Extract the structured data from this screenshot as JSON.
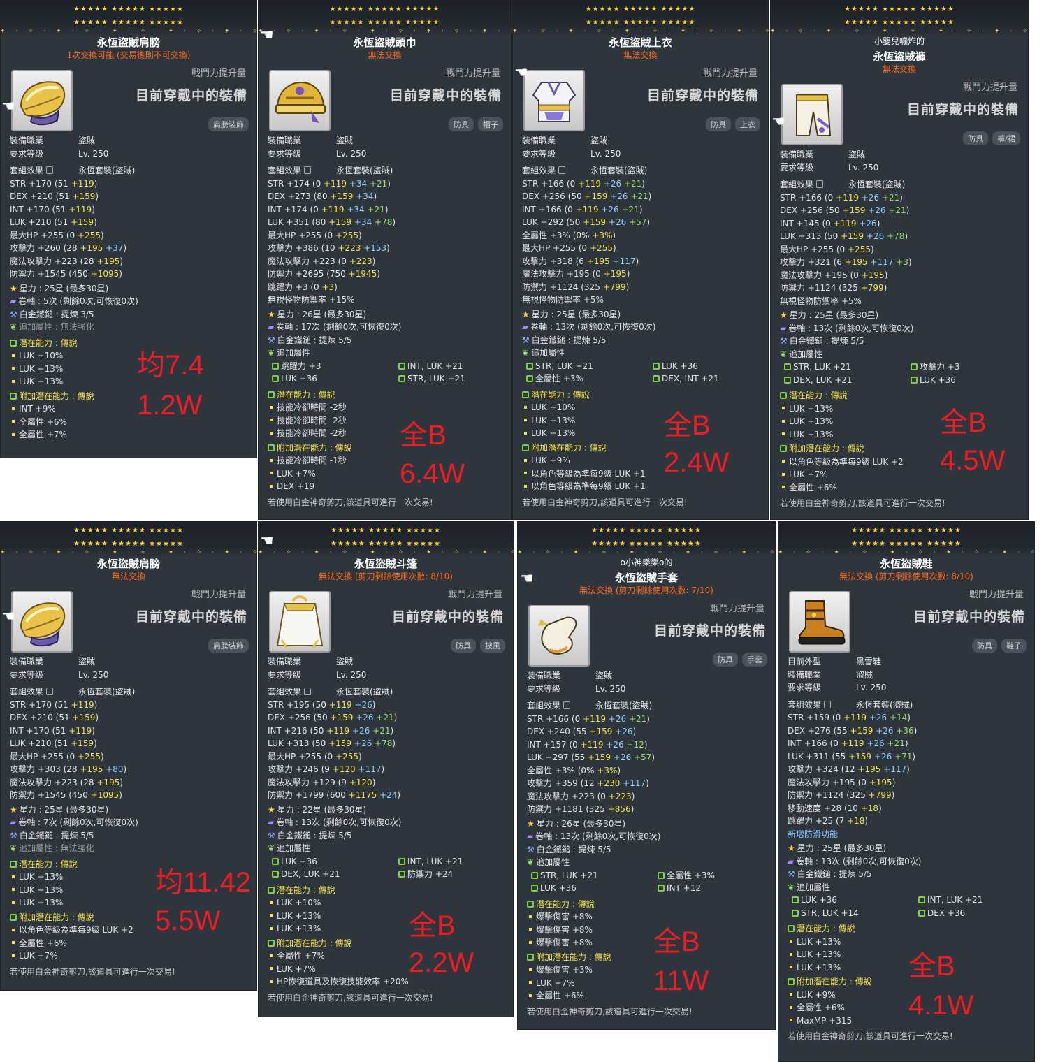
{
  "common": {
    "power_label": "戰鬥力提升量",
    "equipped": "目前穿戴中的裝備",
    "job_label": "裝備職業",
    "job": "盜賊",
    "level_label": "要求等級",
    "level": "Lv. 250",
    "set_label": "套組效果",
    "set_name": "永恆套裝(盜賊)",
    "footer": "若使用白金神奇剪刀,該道具可進行一次交易!"
  },
  "cards": [
    {
      "title": "永恆盜賊肩膀",
      "trade": "1次交換可能 (交易後則不可交換)",
      "tags": [
        "肩膀裝飾"
      ],
      "icon": "shoulder-icon",
      "stats": [
        "STR +170 (51 +119)",
        "DEX +210 (51 +159)",
        "INT +170 (51 +119)",
        "LUK +210 (51 +159)",
        "最大HP +255 (0 +255)",
        "攻擊力 +260 (28 +195 +37)",
        "魔法攻擊力 +223 (28 +195)",
        "防禦力 +1545 (450 +1095)"
      ],
      "star": "星力 : 25星 (最多30星)",
      "scroll": "卷軸 : 5次 (剩餘0次,可恢復0次)",
      "hammer": "白金鐵鎚 : 提煉 3/5",
      "add_label": "追加屬性 : 無法強化",
      "add": [],
      "pot_label": "潛在能力 : 傳說",
      "pot": [
        "LUK +10%",
        "LUK +13%",
        "LUK +13%"
      ],
      "bpot_label": "附加潛在能力 : 傳說",
      "bpot": [
        "INT +9%",
        "全屬性 +6%",
        "全屬性 +7%"
      ],
      "footer": "",
      "ann": [
        "均7.4",
        "1.2W"
      ]
    },
    {
      "title": "永恆盜賊頭巾",
      "trade": "無法交換",
      "tags": [
        "防具",
        "帽子"
      ],
      "icon": "helmet-icon",
      "stats": [
        "STR +174 (0 +119 +34 +21)",
        "DEX +273 (80 +159 +34)",
        "INT +174 (0 +119 +34 +21)",
        "LUK +351 (80 +159 +34 +78)",
        "最大HP +255 (0 +255)",
        "攻擊力 +386 (10 +223 +153)",
        "魔法攻擊力 +223 (0 +223)",
        "防禦力 +2695 (750 +1945)",
        "跳躍力 +3 (0 +3)",
        "無視怪物防禦率 +15%"
      ],
      "star": "星力 : 26星 (最多30星)",
      "scroll": "卷軸 : 17次 (剩餘0次,可恢復0次)",
      "hammer": "白金鐵鎚 : 提煉 5/5",
      "add_label": "追加屬性",
      "add": [
        "跳躍力 +3",
        "INT, LUK +21",
        "LUK +36",
        "STR, LUK +21"
      ],
      "pot_label": "潛在能力 : 傳說",
      "pot": [
        "技能冷卻時間 -2秒",
        "技能冷卻時間 -2秒",
        "技能冷卻時間 -2秒"
      ],
      "bpot_label": "附加潛在能力 : 傳說",
      "bpot": [
        "技能冷卻時間 -1秒",
        "LUK +7%",
        "DEX +19"
      ],
      "footer": "若使用白金神奇剪刀,該道具可進行一次交易!",
      "ann": [
        "全B",
        "6.4W"
      ]
    },
    {
      "title": "永恆盜賊上衣",
      "trade": "無法交換",
      "tags": [
        "防具",
        "上衣"
      ],
      "icon": "top-icon",
      "stats": [
        "STR +166 (0 +119 +26 +21)",
        "DEX +256 (50 +159 +26 +21)",
        "INT +166 (0 +119 +26 +21)",
        "LUK +292 (50 +159 +26 +57)",
        "全屬性 +3% (0% +3%)",
        "最大HP +255 (0 +255)",
        "攻擊力 +318 (6 +195 +117)",
        "魔法攻擊力 +195 (0 +195)",
        "防禦力 +1124 (325 +799)",
        "無視怪物防禦率 +5%"
      ],
      "star": "星力 : 25星 (最多30星)",
      "scroll": "卷軸 : 13次 (剩餘0次,可恢復0次)",
      "hammer": "白金鐵鎚 : 提煉 5/5",
      "add_label": "追加屬性",
      "add": [
        "STR, LUK +21",
        "LUK +36",
        "全屬性 +3%",
        "DEX, INT +21"
      ],
      "pot_label": "潛在能力 : 傳說",
      "pot": [
        "LUK +10%",
        "LUK +13%",
        "LUK +13%"
      ],
      "bpot_label": "附加潛在能力 : 傳說",
      "bpot": [
        "LUK +9%",
        "以角色等級為準每9級 LUK +1",
        "以角色等級為準每9級 LUK +1"
      ],
      "footer": "若使用白金神奇剪刀,該道具可進行一次交易!",
      "ann": [
        "全B",
        "2.4W"
      ]
    },
    {
      "owner": "小嬰兒嘣炸的",
      "title": "永恆盜賊褲",
      "trade": "無法交換",
      "tags": [
        "防具",
        "褲/裙"
      ],
      "icon": "pants-icon",
      "stats": [
        "STR +166 (0 +119 +26 +21)",
        "DEX +256 (50 +159 +26 +21)",
        "INT +145 (0 +119 +26)",
        "LUK +313 (50 +159 +26 +78)",
        "最大HP +255 (0 +255)",
        "攻擊力 +321 (6 +195 +117 +3)",
        "魔法攻擊力 +195 (0 +195)",
        "防禦力 +1124 (325 +799)",
        "無視怪物防禦率 +5%"
      ],
      "star": "星力 : 25星 (最多30星)",
      "scroll": "卷軸 : 13次 (剩餘0次,可恢復0次)",
      "hammer": "白金鐵鎚 : 提煉 5/5",
      "add_label": "追加屬性",
      "add": [
        "STR, LUK +21",
        "攻擊力 +3",
        "DEX, LUK +21",
        "LUK +36"
      ],
      "pot_label": "潛在能力 : 傳說",
      "pot": [
        "LUK +13%",
        "LUK +13%",
        "LUK +13%"
      ],
      "bpot_label": "附加潛在能力 : 傳說",
      "bpot": [
        "以角色等級為準每9級 LUK +2",
        "LUK +7%",
        "全屬性 +6%"
      ],
      "footer": "若使用白金神奇剪刀,該道具可進行一次交易!",
      "ann": [
        "全B",
        "4.5W"
      ]
    },
    {
      "title": "永恆盜賊肩膀",
      "trade": "無法交換",
      "tags": [
        "肩膀裝飾"
      ],
      "icon": "shoulder-icon",
      "stats": [
        "STR +170 (51 +119)",
        "DEX +210 (51 +159)",
        "INT +170 (51 +119)",
        "LUK +210 (51 +159)",
        "最大HP +255 (0 +255)",
        "攻擊力 +303 (28 +195 +80)",
        "魔法攻擊力 +223 (28 +195)",
        "防禦力 +1545 (450 +1095)"
      ],
      "star": "星力 : 25星 (最多30星)",
      "scroll": "卷軸 : 7次 (剩餘0次,可恢復0次)",
      "hammer": "白金鐵鎚 : 提煉 5/5",
      "add_label": "追加屬性 : 無法強化",
      "add": [],
      "pot_label": "潛在能力 : 傳說",
      "pot": [
        "LUK +13%",
        "LUK +13%",
        "LUK +13%"
      ],
      "bpot_label": "附加潛在能力 : 傳說",
      "bpot": [
        "以角色等級為準每9級 LUK +2",
        "全屬性 +6%",
        "LUK +7%"
      ],
      "footer": "若使用白金神奇剪刀,該道具可進行一次交易!",
      "ann": [
        "均11.42",
        "5.5W"
      ]
    },
    {
      "title": "永恆盜賊斗篷",
      "trade": "無法交換 (剪刀剩餘使用次數: 8/10)",
      "tags": [
        "防具",
        "披風"
      ],
      "icon": "cape-icon",
      "stats": [
        "STR +195 (50 +119 +26)",
        "DEX +256 (50 +159 +26 +21)",
        "INT +216 (50 +119 +26 +21)",
        "LUK +313 (50 +159 +26 +78)",
        "最大HP +255 (0 +255)",
        "攻擊力 +246 (9 +120 +117)",
        "魔法攻擊力 +129 (9 +120)",
        "防禦力 +1799 (600 +1175 +24)"
      ],
      "star": "星力 : 22星 (最多30星)",
      "scroll": "卷軸 : 13次 (剩餘0次,可恢復0次)",
      "hammer": "白金鐵鎚 : 提煉 5/5",
      "add_label": "追加屬性",
      "add": [
        "LUK +36",
        "INT, LUK +21",
        "DEX, LUK +21",
        "防禦力 +24"
      ],
      "pot_label": "潛在能力 : 傳說",
      "pot": [
        "LUK +10%",
        "LUK +13%",
        "LUK +13%"
      ],
      "bpot_label": "附加潛在能力 : 傳說",
      "bpot": [
        "全屬性 +7%",
        "LUK +7%",
        "HP恢復道具及恢復技能效率 +20%"
      ],
      "footer": "若使用白金神奇剪刀,該道具可進行一次交易!",
      "ann": [
        "全B",
        "2.2W"
      ]
    },
    {
      "owner": "o小神樂樂o的",
      "title": "永恆盜賊手套",
      "trade": "無法交換 (剪刀剩餘使用次數: 7/10)",
      "tags": [
        "防具",
        "手套"
      ],
      "icon": "glove-icon",
      "stats": [
        "STR +166 (0 +119 +26 +21)",
        "DEX +240 (55 +159 +26)",
        "INT +157 (0 +119 +26 +12)",
        "LUK +297 (55 +159 +26 +57)",
        "全屬性 +3% (0% +3%)",
        "攻擊力 +359 (12 +230 +117)",
        "魔法攻擊力 +223 (0 +223)",
        "防禦力 +1181 (325 +856)"
      ],
      "star": "星力 : 26星 (最多30星)",
      "scroll": "卷軸 : 13次 (剩餘0次,可恢復0次)",
      "hammer": "白金鐵鎚 : 提煉 5/5",
      "add_label": "追加屬性",
      "add": [
        "STR, LUK +21",
        "全屬性 +3%",
        "LUK +36",
        "INT +12"
      ],
      "pot_label": "潛在能力 : 傳說",
      "pot": [
        "爆擊傷害 +8%",
        "爆擊傷害 +8%",
        "爆擊傷害 +8%"
      ],
      "bpot_label": "附加潛在能力 : 傳說",
      "bpot": [
        "爆擊傷害 +3%",
        "LUK +7%",
        "全屬性 +6%"
      ],
      "footer": "若使用白金神奇剪刀,該道具可進行一次交易!",
      "ann": [
        "全B",
        "11W"
      ]
    },
    {
      "title": "永恆盜賊鞋",
      "trade": "無法交換 (剪刀剩餘使用次數: 8/10)",
      "tags": [
        "防具",
        "鞋子"
      ],
      "icon": "shoe-icon",
      "appearance_label": "目前外型",
      "appearance": "黑雪鞋",
      "stats": [
        "STR +159 (0 +119 +26 +14)",
        "DEX +276 (55 +159 +26 +36)",
        "INT +166 (0 +119 +26 +21)",
        "LUK +311 (55 +159 +26 +71)",
        "攻擊力 +324 (12 +195 +117)",
        "魔法攻擊力 +195 (0 +195)",
        "防禦力 +1124 (325 +799)",
        "移動速度 +28 (10 +18)",
        "跳躍力 +25 (7 +18)",
        "新增防滑功能"
      ],
      "star": "星力 : 25星 (最多30星)",
      "scroll": "卷軸 : 13次 (剩餘0次,可恢復0次)",
      "hammer": "白金鐵鎚 : 提煉 5/5",
      "add_label": "追加屬性",
      "add": [
        "LUK +36",
        "INT, LUK +21",
        "STR, LUK +14",
        "DEX +36"
      ],
      "pot_label": "潛在能力 : 傳說",
      "pot": [
        "LUK +13%",
        "LUK +13%",
        "LUK +13%"
      ],
      "bpot_label": "附加潛在能力 : 傳說",
      "bpot": [
        "LUK +9%",
        "全屬性 +6%",
        "MaxMP +315"
      ],
      "footer": "若使用白金神奇剪刀,該道具可進行一次交易!",
      "ann": [
        "全B",
        "4.1W"
      ]
    }
  ]
}
